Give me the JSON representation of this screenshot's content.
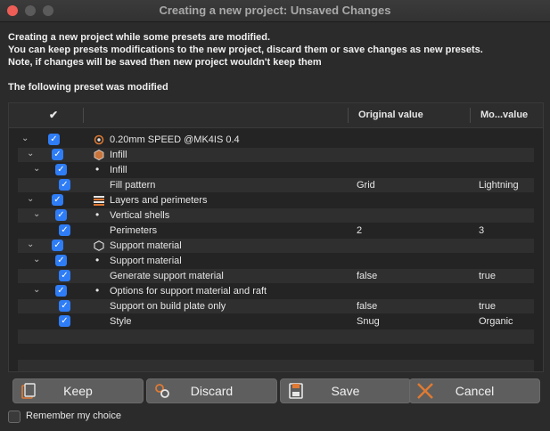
{
  "window": {
    "title": "Creating a new project: Unsaved Changes"
  },
  "message": {
    "line1": "Creating a new project while some presets are modified.",
    "line2": "You can keep presets modifications to the new project, discard them or save changes as new presets.",
    "line3": "Note, if changes will be saved then new project wouldn't keep them"
  },
  "subheading": "The following preset was modified",
  "grid": {
    "headers": {
      "check": "✔",
      "original": "Original value",
      "modified": "Mo...value"
    },
    "rows": [
      {
        "label": "0.20mm SPEED @MK4IS 0.4",
        "original": "",
        "modified": ""
      },
      {
        "label": "Infill",
        "original": "",
        "modified": ""
      },
      {
        "label": "Infill",
        "original": "",
        "modified": ""
      },
      {
        "label": "Fill pattern",
        "original": "Grid",
        "modified": "Lightning"
      },
      {
        "label": "Layers and perimeters",
        "original": "",
        "modified": ""
      },
      {
        "label": "Vertical shells",
        "original": "",
        "modified": ""
      },
      {
        "label": "Perimeters",
        "original": "2",
        "modified": "3"
      },
      {
        "label": "Support material",
        "original": "",
        "modified": ""
      },
      {
        "label": "Support material",
        "original": "",
        "modified": ""
      },
      {
        "label": "Generate support material",
        "original": "false",
        "modified": "true"
      },
      {
        "label": "Options for support material and raft",
        "original": "",
        "modified": ""
      },
      {
        "label": "Support on build plate only",
        "original": "false",
        "modified": "true"
      },
      {
        "label": "Style",
        "original": "Snug",
        "modified": "Organic"
      }
    ]
  },
  "buttons": {
    "keep": "Keep",
    "discard": "Discard",
    "save": "Save",
    "cancel": "Cancel"
  },
  "remember": {
    "label": "Remember my choice",
    "checked": false
  },
  "colors": {
    "accent": "#2f7df6",
    "close": "#ee5e56",
    "orange": "#e07a33"
  }
}
